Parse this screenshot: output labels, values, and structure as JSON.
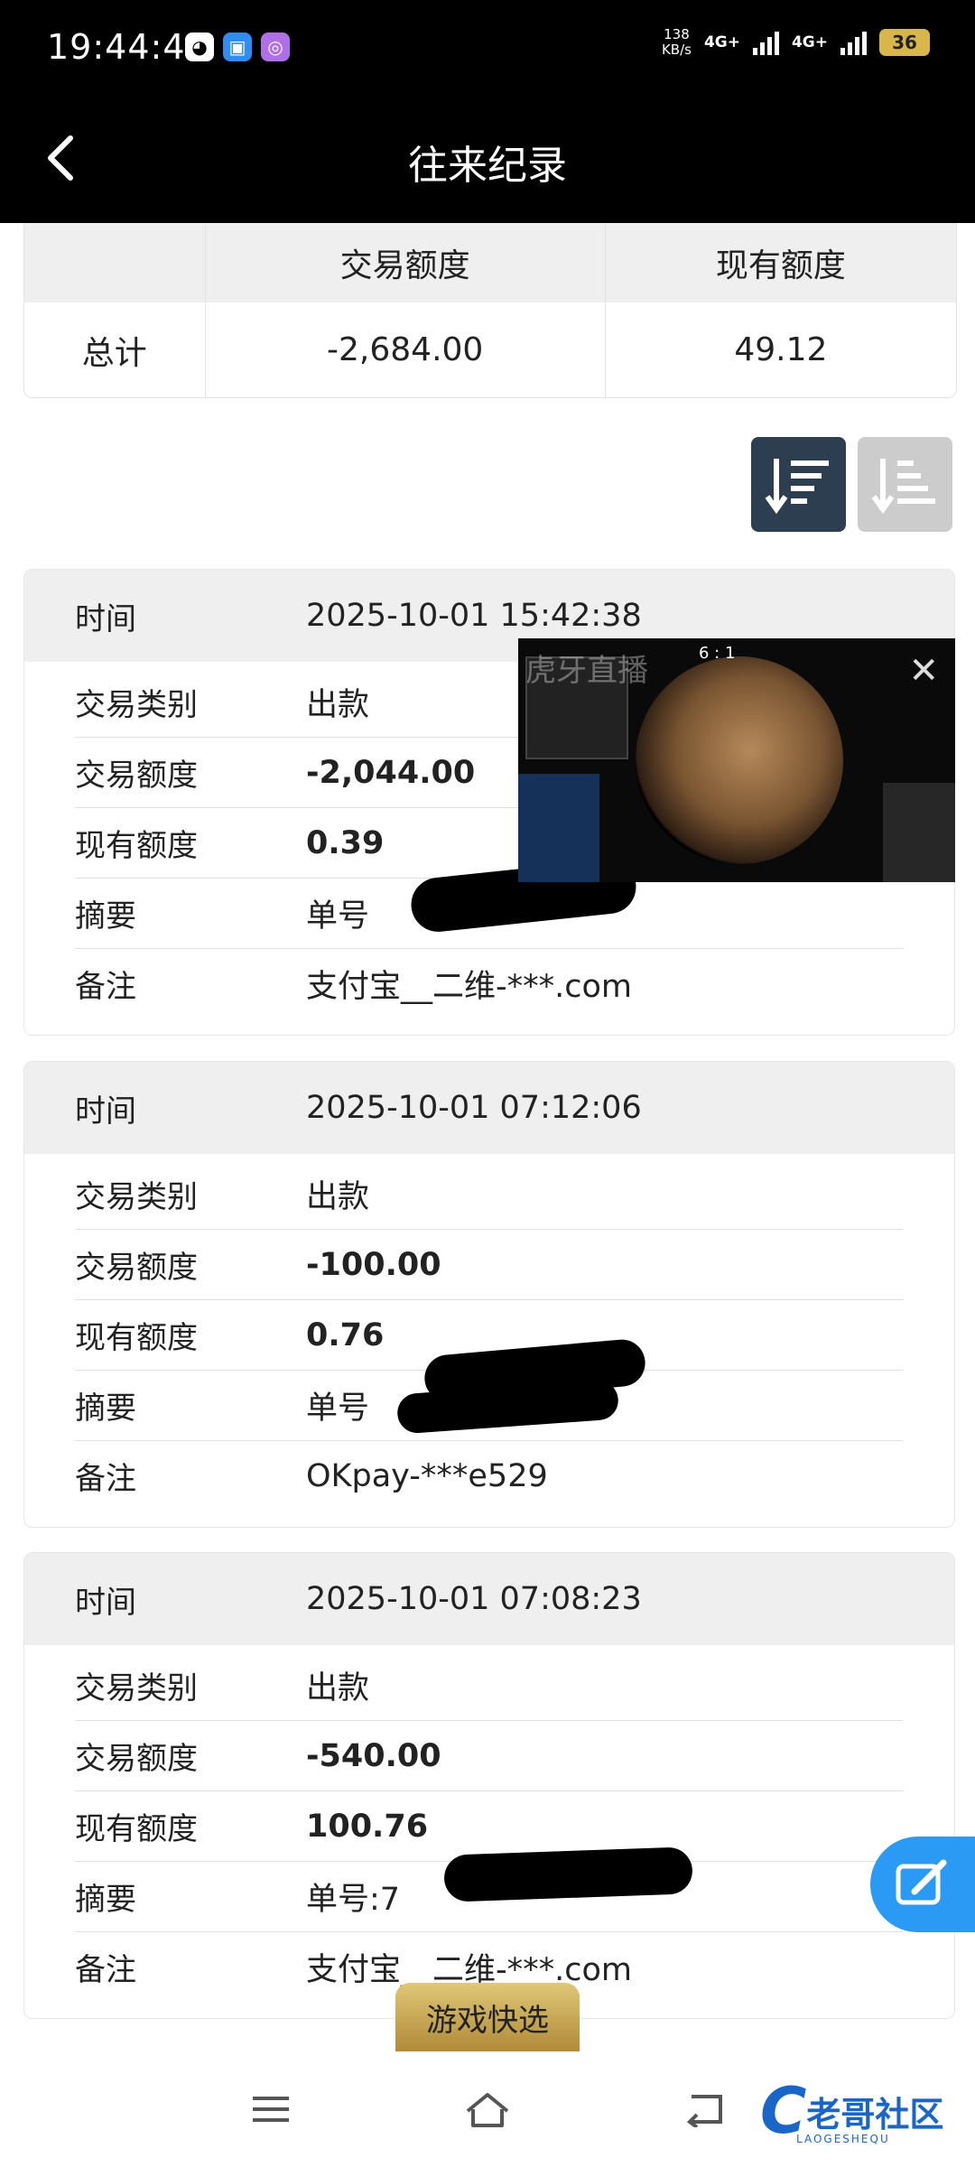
{
  "status_bar": {
    "time": "19:44:49",
    "speed_value": "138",
    "speed_unit": "KB/s",
    "net1": "4G+",
    "net2": "4G+",
    "battery": "36"
  },
  "header": {
    "title": "往来纪录"
  },
  "summary": {
    "col_amount": "交易额度",
    "col_balance": "现有额度",
    "total_label": "总计",
    "total_amount": "-2,684.00",
    "total_balance": "49.12"
  },
  "labels": {
    "time": "时间",
    "type": "交易类别",
    "amount": "交易额度",
    "balance": "现有额度",
    "summary": "摘要",
    "note": "备注"
  },
  "records": [
    {
      "time": "2025-10-01 15:42:38",
      "type": "出款",
      "amount": "-2,044.00",
      "balance": "0.39",
      "summary": "单号",
      "note": "支付宝__二维-***.com"
    },
    {
      "time": "2025-10-01 07:12:06",
      "type": "出款",
      "amount": "-100.00",
      "balance": "0.76",
      "summary": "单号",
      "note": "OKpay-***e529"
    },
    {
      "time": "2025-10-01 07:08:23",
      "type": "出款",
      "amount": "-540.00",
      "balance": "100.76",
      "summary": "单号:7",
      "note": "支付宝__二维-***.com"
    }
  ],
  "video": {
    "watermark": "虎牙直播",
    "score": "6 : 1"
  },
  "game_tab": "游戏快选",
  "logo": {
    "name": "老哥社区",
    "sub": "LAOGESHEQU"
  },
  "colors": {
    "header_bg": "#000000",
    "sort_active": "#2c3e50",
    "sort_inactive": "#cccccc",
    "fab": "#2a9af5"
  }
}
